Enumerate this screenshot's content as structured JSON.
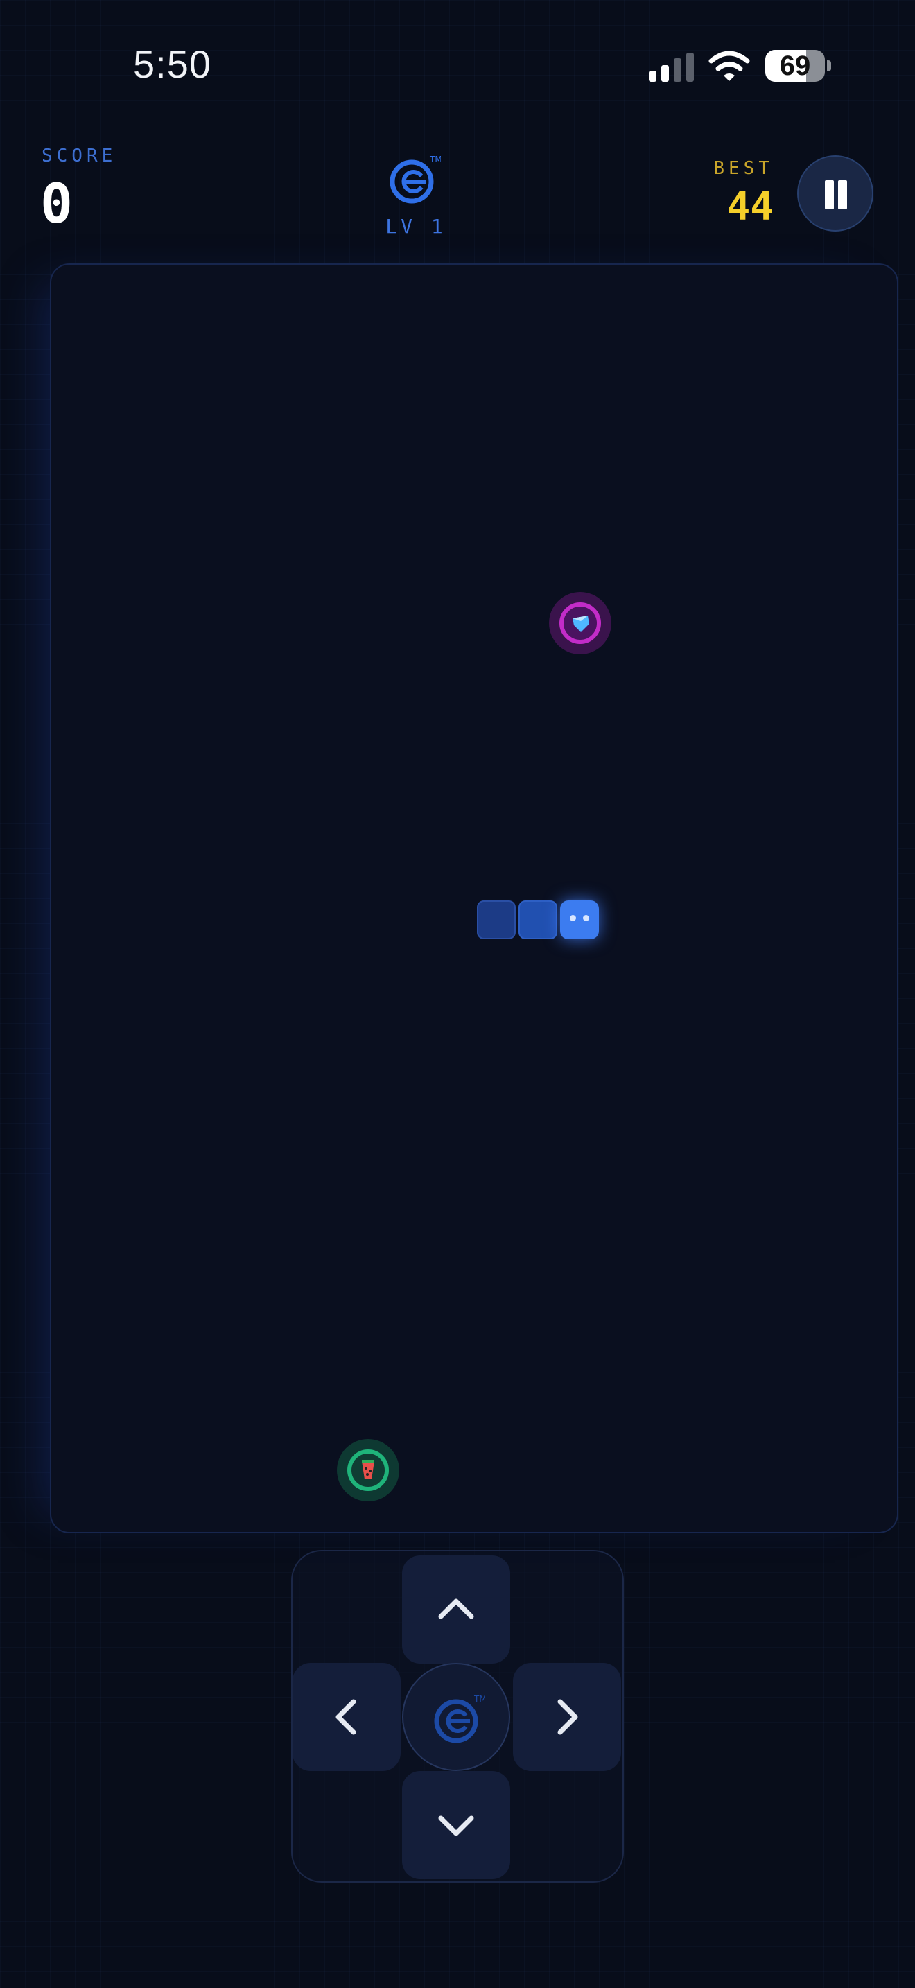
{
  "status_bar": {
    "time": "5:50",
    "battery": 69
  },
  "hud": {
    "score_label": "SCORE",
    "score_value": "0",
    "level_label": "LV 1",
    "best_label": "BEST",
    "best_value": "44"
  },
  "colors": {
    "accent": "#3d74e0",
    "best": "#f5cf2a",
    "snake_head": "#3c7cf0",
    "gem_food": "#c22cc8",
    "melon_food": "#1fb37a"
  },
  "icons": {
    "logo": "brand-logo-icon",
    "pause": "pause-icon",
    "gem_food": "gem-icon",
    "melon_food": "watermelon-icon",
    "up": "chevron-up-icon",
    "down": "chevron-down-icon",
    "left": "chevron-left-icon",
    "right": "chevron-right-icon"
  },
  "game": {
    "snake_length": 3,
    "direction": "right"
  }
}
